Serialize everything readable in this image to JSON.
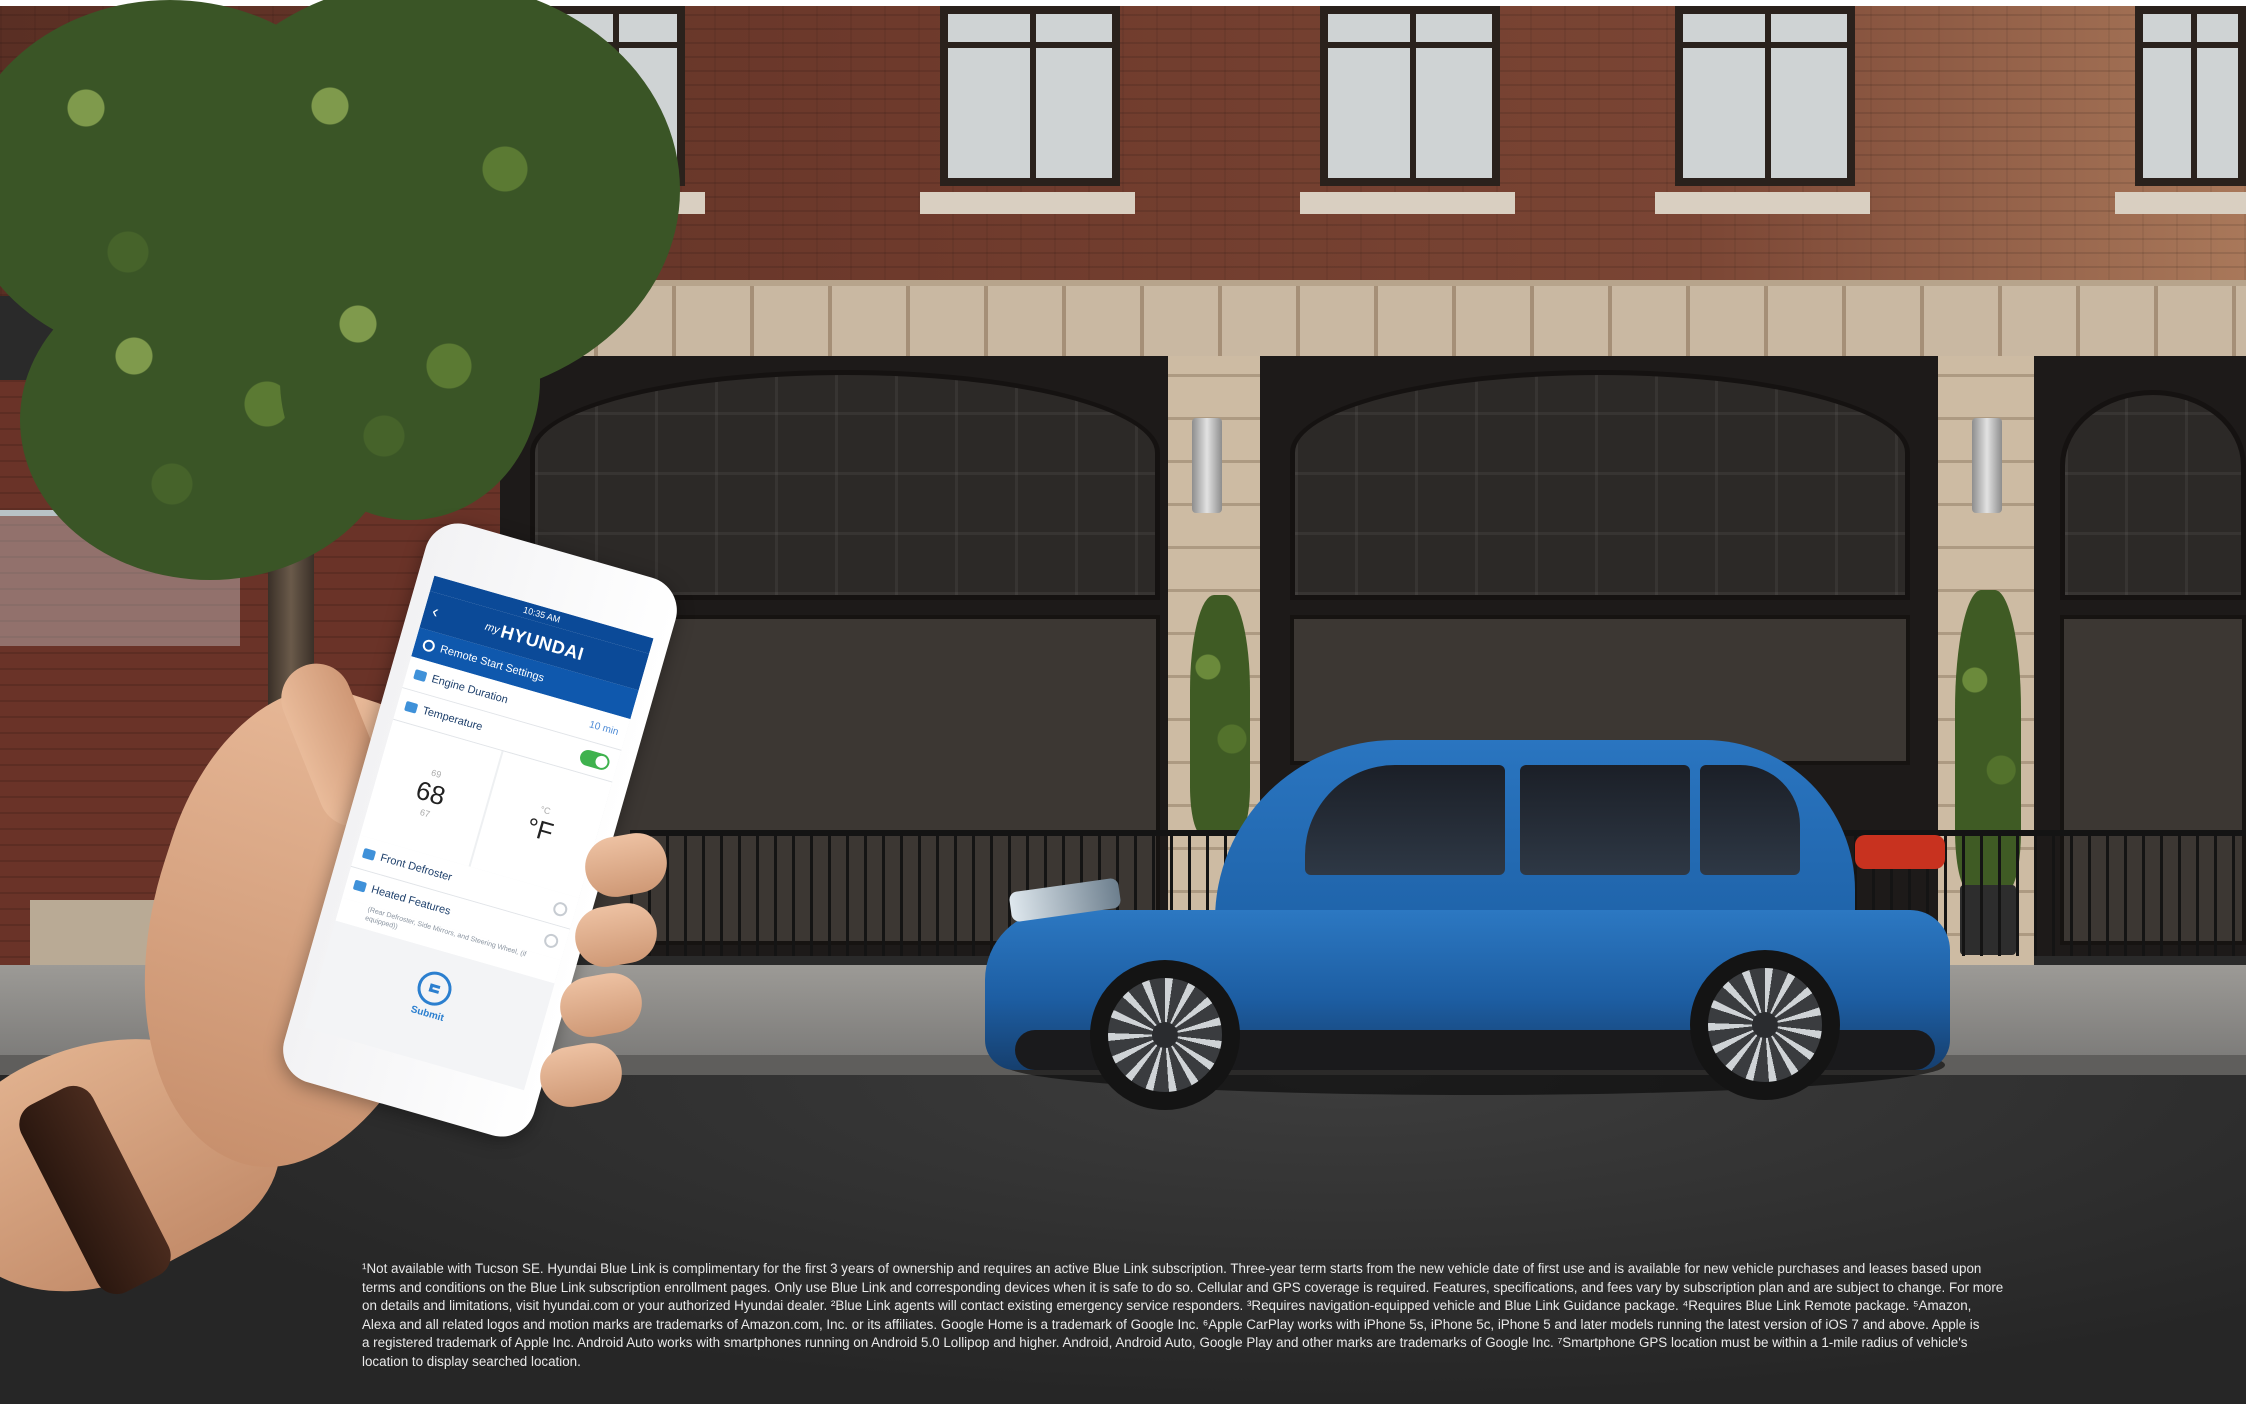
{
  "phone": {
    "status_time": "10:35 AM",
    "brand_prefix": "my",
    "brand_name": "HYUNDAI",
    "section_title": "Remote Start Settings",
    "engine_duration_label": "Engine Duration",
    "engine_duration_value": "10 min",
    "temperature_label": "Temperature",
    "temp_above": "69",
    "temp_value": "68",
    "temp_below": "67",
    "unit_alt": "°C",
    "unit_value": "°F",
    "front_defroster_label": "Front Defroster",
    "heated_features_label": "Heated Features",
    "heated_features_note": "(Rear Defroster, Side Mirrors, and Steering Wheel, (if equipped))",
    "submit_label": "Submit"
  },
  "disclaimer": {
    "line1": "¹Not available with Tucson SE. Hyundai Blue Link is complimentary for the first 3 years of ownership and requires an active Blue Link subscription. Three-year term starts from the new vehicle date of first use and is available for new vehicle purchases and leases based upon",
    "line2": "terms and conditions on the Blue Link subscription enrollment pages. Only use Blue Link and corresponding devices when it is safe to do so. Cellular and GPS coverage is required. Features, specifications, and fees vary by subscription plan and are subject to change. For more",
    "line3": "on details and limitations, visit hyundai.com or your authorized Hyundai dealer. ²Blue Link agents will contact existing emergency service responders. ³Requires navigation-equipped vehicle and Blue Link Guidance package. ⁴Requires Blue Link Remote package. ⁵Amazon,",
    "line4": "Alexa and all related logos and motion marks are trademarks of Amazon.com, Inc. or its affiliates. Google Home is a trademark of Google Inc. ⁶Apple CarPlay works with iPhone 5s, iPhone 5c, iPhone 5 and later models running the latest version of iOS 7 and above. Apple is",
    "line5": "a registered trademark of Apple Inc. Android Auto works with smartphones running on Android 5.0 Lollipop and higher. Android, Android Auto, Google Play and other marks are trademarks of Google Inc. ⁷Smartphone GPS location must be within a 1-mile radius of vehicle's",
    "line6": "location to display searched location."
  },
  "colors": {
    "app_blue": "#0b4a98",
    "toggle_green": "#3fb24e",
    "car_blue": "#1e62a8"
  }
}
